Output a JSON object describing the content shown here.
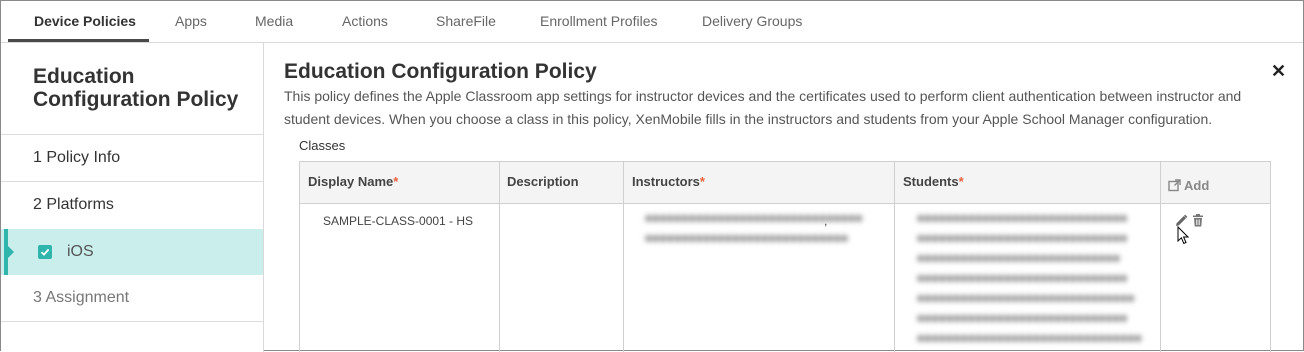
{
  "topnav": {
    "tabs": [
      {
        "label": "Device Policies",
        "active": true
      },
      {
        "label": "Apps"
      },
      {
        "label": "Media"
      },
      {
        "label": "Actions"
      },
      {
        "label": "ShareFile"
      },
      {
        "label": "Enrollment Profiles"
      },
      {
        "label": "Delivery Groups"
      }
    ]
  },
  "sidebar": {
    "title": "Education Configuration Policy",
    "items": [
      {
        "label": "1  Policy Info"
      },
      {
        "label": "2  Platforms"
      },
      {
        "label": "iOS",
        "selected": true,
        "checked": true
      },
      {
        "label": "3  Assignment",
        "disabled": true
      }
    ]
  },
  "main": {
    "title": "Education Configuration Policy",
    "description": "This policy defines the Apple Classroom app settings for instructor devices and the certificates used to perform client authentication between instructor and student devices. When you choose a class in this policy, XenMobile fills in the instructors and students from your Apple School Manager configuration.",
    "classes_label": "Classes",
    "table": {
      "columns": [
        {
          "label": "Display Name",
          "required": "*"
        },
        {
          "label": "Description"
        },
        {
          "label": "Instructors",
          "required": "*"
        },
        {
          "label": "Students",
          "required": "*"
        }
      ],
      "add_label": "Add",
      "rows": [
        {
          "display_name": "SAMPLE-CLASS-0001 - HS",
          "description": "",
          "instructors_separator": ","
        }
      ]
    }
  },
  "colors": {
    "accent": "#2fb5ab",
    "selected_bg": "#c9eeec",
    "required": "#e8623f"
  },
  "icons": [
    "close-icon",
    "add-icon",
    "edit-icon",
    "delete-icon",
    "checkbox-checked-icon",
    "mouse-pointer-icon"
  ]
}
